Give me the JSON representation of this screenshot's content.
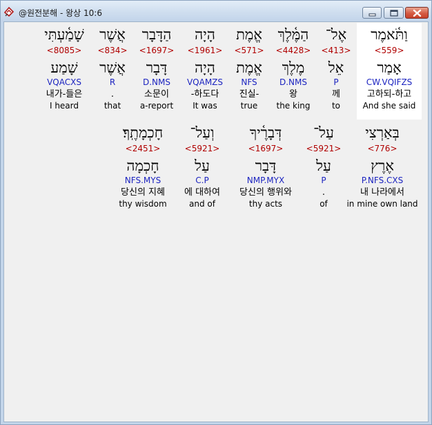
{
  "window": {
    "title": "@원전분해 - 왕상 10:6",
    "icon": "app-book-icon"
  },
  "rows": [
    [
      {
        "heb": "וַתֹּ֫אמֶר",
        "strong": "<559>",
        "lex": "אָמַר",
        "parse": "CW.VQIFZS",
        "kor": "고하되-하고",
        "eng": "And she said"
      },
      {
        "heb": "אֶל־",
        "strong": "<413>",
        "lex": "אֵל",
        "parse": "P",
        "kor": "께",
        "eng": "to"
      },
      {
        "heb": "הַמֶּ֫לֶךְ",
        "strong": "<4428>",
        "lex": "מֶלֶךְ",
        "parse": "D.NMS",
        "kor": "왕",
        "eng": "the king"
      },
      {
        "heb": "אֱמֶת",
        "strong": "<571>",
        "lex": "אֱמֶת",
        "parse": "NFS",
        "kor": "진실-",
        "eng": "true"
      },
      {
        "heb": "הָיָה",
        "strong": "<1961>",
        "lex": "הָיָה",
        "parse": "VQAMZS",
        "kor": "-하도다",
        "eng": "It was"
      },
      {
        "heb": "הַדָּבָר",
        "strong": "<1697>",
        "lex": "דָּבָר",
        "parse": "D.NMS",
        "kor": "소문이",
        "eng": "a-report"
      },
      {
        "heb": "אֲשֶׁר",
        "strong": "<834>",
        "lex": "אֲשֶׁר",
        "parse": "R",
        "kor": ".",
        "eng": "that"
      },
      {
        "heb": "שָׁמַ֫עְתִּי",
        "strong": "<8085>",
        "lex": "שָׁמַע",
        "parse": "VQACXS",
        "kor": "내가-들은",
        "eng": "I heard"
      }
    ],
    [
      {
        "heb": "בְּאַרְצִי",
        "strong": "<776>",
        "lex": "אֶרֶץ",
        "parse": "P.NFS.CXS",
        "kor": "내 나라에서",
        "eng": "in mine own land"
      },
      {
        "heb": "עַל־",
        "strong": "<5921>",
        "lex": "עַל",
        "parse": "P",
        "kor": ".",
        "eng": "of"
      },
      {
        "heb": "דְּבָרֶ֫יךָ",
        "strong": "<1697>",
        "lex": "דָּבָר",
        "parse": "NMP.MYX",
        "kor": "당신의 행위와",
        "eng": "thy acts"
      },
      {
        "heb": "וְעַל־",
        "strong": "<5921>",
        "lex": "עַל",
        "parse": "C.P",
        "kor": "에 대하여",
        "eng": "and of"
      },
      {
        "heb": "חָכְמָתֶֽךָ׃",
        "strong": "<2451>",
        "lex": "חָכְמָה",
        "parse": "NFS.MYS",
        "kor": "당신의 지혜",
        "eng": "thy wisdom"
      }
    ]
  ]
}
